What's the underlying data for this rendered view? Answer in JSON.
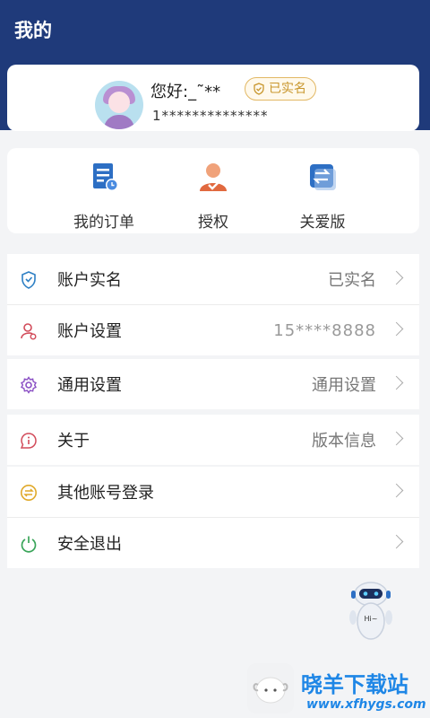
{
  "header": {
    "title": "我的"
  },
  "profile": {
    "greeting": "您好:_˜**",
    "verified_label": "已实名",
    "phone_masked": "1**************"
  },
  "quick_actions": [
    {
      "label": "我的订单",
      "icon": "order-icon"
    },
    {
      "label": "授权",
      "icon": "authorize-icon"
    },
    {
      "label": "关爱版",
      "icon": "care-mode-icon"
    }
  ],
  "groups": [
    [
      {
        "label": "账户实名",
        "value": "已实名",
        "icon": "shield-id-icon"
      },
      {
        "label": "账户设置",
        "value": "15****8888",
        "icon": "user-settings-icon"
      }
    ],
    [
      {
        "label": "通用设置",
        "value": "通用设置",
        "icon": "gear-icon"
      }
    ],
    [
      {
        "label": "关于",
        "value": "版本信息",
        "icon": "info-icon"
      }
    ],
    [
      {
        "label": "其他账号登录",
        "value": "",
        "icon": "switch-account-icon"
      },
      {
        "label": "安全退出",
        "value": "",
        "icon": "power-icon"
      }
    ]
  ],
  "watermark": {
    "title": "晓羊下载站",
    "url": "www.xfhygs.com"
  },
  "robot": {
    "label": "Hi~"
  },
  "colors": {
    "header": "#1f3a7a",
    "badge": "#c8962c",
    "watermark": "#1e86e6"
  }
}
